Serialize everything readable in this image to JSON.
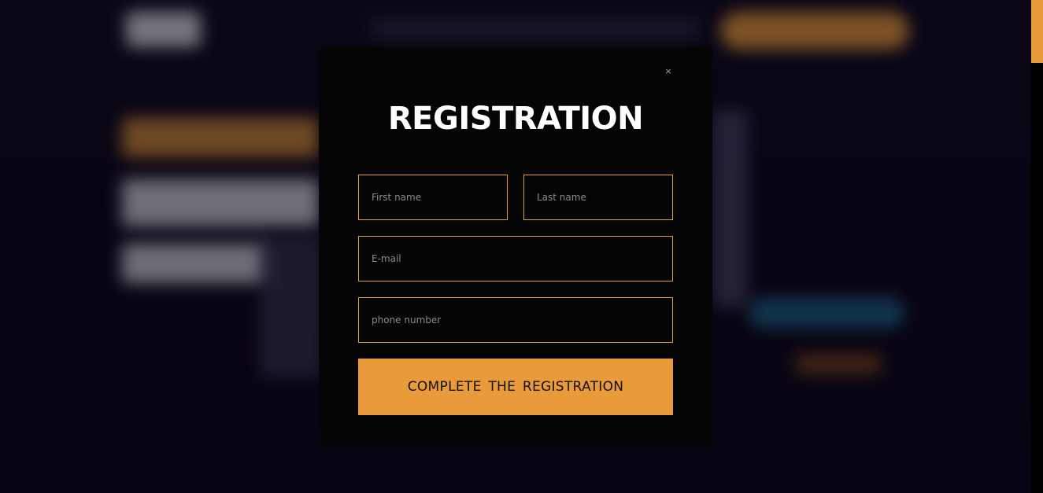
{
  "modal": {
    "close_glyph": "×",
    "title": "REGISTRATION",
    "fields": {
      "first_name_placeholder": "First name",
      "last_name_placeholder": "Last name",
      "email_placeholder": "E-mail",
      "phone_placeholder": "phone number"
    },
    "submit_label": "COMPLETE THE REGISTRATION"
  },
  "colors": {
    "accent": "#e99a3b",
    "modal_bg": "#050505",
    "page_bg": "#0a0514",
    "title": "#ffffff"
  },
  "icons": {
    "close": "close-icon"
  }
}
